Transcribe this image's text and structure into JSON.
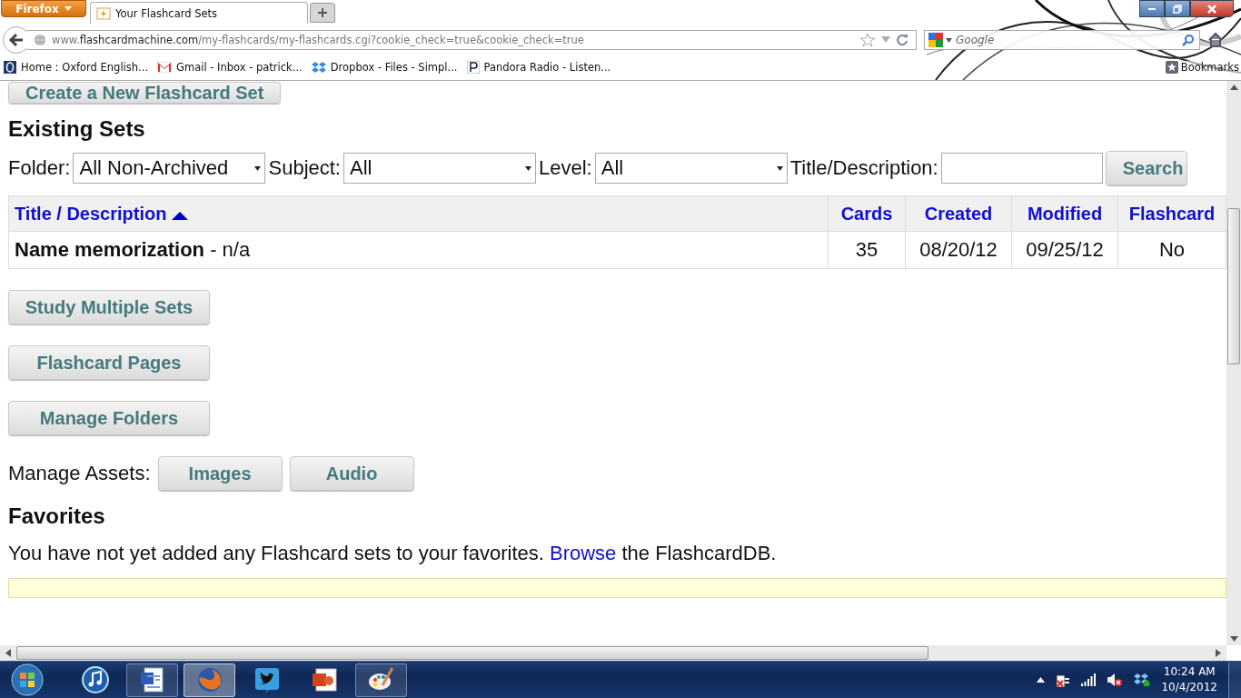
{
  "browser": {
    "menu_button": "Firefox",
    "tabs": [
      {
        "title": "Your Flashcard Sets",
        "selected": true
      }
    ],
    "address": {
      "prefix": "www.",
      "domain": "flashcardmachine.com",
      "path": "/my-flashcards/my-flashcards.cgi?cookie_check=true&cookie_check=true"
    },
    "search": {
      "placeholder": "Google"
    },
    "bookmarks": [
      {
        "kind": "oxford",
        "label": "Home : Oxford English..."
      },
      {
        "kind": "gmail",
        "label": "Gmail - Inbox - patrick..."
      },
      {
        "kind": "dropbox",
        "label": "Dropbox - Files - Simpl..."
      },
      {
        "kind": "pandora",
        "label": "Pandora Radio - Listen..."
      }
    ],
    "bookmarks_menu": "Bookmarks"
  },
  "page": {
    "create_button": "Create a New Flashcard Set",
    "existing_heading": "Existing Sets",
    "filters": [
      {
        "kind": "select",
        "label": "Folder:",
        "value": "All Non-Archived"
      },
      {
        "kind": "select",
        "label": "Subject:",
        "value": "All"
      },
      {
        "kind": "select",
        "label": "Level:",
        "value": "All"
      },
      {
        "kind": "text",
        "label": "Title/Description:"
      }
    ],
    "search_button": "Search",
    "table": {
      "columns": [
        {
          "label": "Title / Description",
          "sorted": true
        },
        {
          "label": "Cards",
          "sorted": false
        },
        {
          "label": "Created",
          "sorted": false
        },
        {
          "label": "Modified",
          "sorted": false
        },
        {
          "label": "Flashcard",
          "sorted": false
        }
      ],
      "rows": [
        {
          "title": "**Name memorization** - n/a",
          "cards": "35",
          "created": "08/20/12",
          "modified": "09/25/12",
          "flashcard": "No"
        }
      ]
    },
    "action_buttons": [
      "Study Multiple Sets",
      "Flashcard Pages",
      "Manage Folders"
    ],
    "assets_label": "Manage Assets:",
    "asset_buttons": [
      "Images",
      "Audio"
    ],
    "favorites_heading": "Favorites",
    "favorites_text_before": "You have not yet added any Flashcard sets to your favorites.",
    "favorites_link": "Browse",
    "favorites_text_after": "the FlashcardDB."
  },
  "taskbar": {
    "apps": [
      {
        "kind": "itunes",
        "running": false,
        "selected": false
      },
      {
        "kind": "word",
        "running": true,
        "selected": false
      },
      {
        "kind": "firefox",
        "running": true,
        "selected": true
      },
      {
        "kind": "twitter",
        "running": false,
        "selected": false
      },
      {
        "kind": "powerpoint",
        "running": false,
        "selected": false
      },
      {
        "kind": "paint",
        "running": true,
        "selected": false
      }
    ],
    "time": "10:24 AM",
    "date": "10/4/2012"
  }
}
